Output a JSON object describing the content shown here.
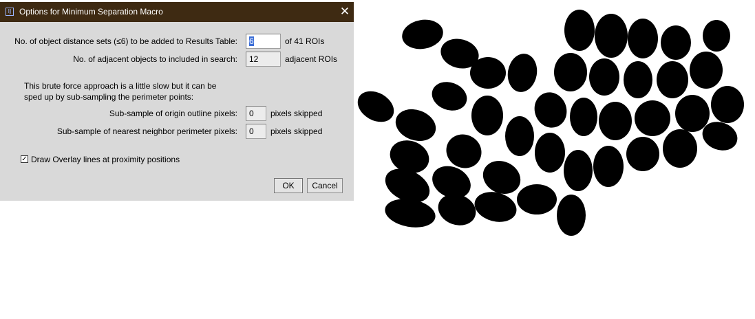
{
  "dialog": {
    "title": "Options for Minimum Separation Macro",
    "title_icon": "imagej-icon",
    "close_icon": "close-icon",
    "row1": {
      "label": "No. of object distance sets (≤6) to be added to Results Table:",
      "value": "6",
      "suffix": "of 41 ROIs"
    },
    "row2": {
      "label": "No. of adjacent objects to included in search:",
      "value": "12",
      "suffix": "adjacent ROIs"
    },
    "info_line1": "This brute force approach is a little slow but it can be",
    "info_line2": "sped up by sub-sampling the perimeter points:",
    "row3": {
      "label": "Sub-sample of origin outline pixels:",
      "value": "0",
      "suffix": "pixels skipped"
    },
    "row4": {
      "label": "Sub-sample of nearest neighbor perimeter pixels:",
      "value": "0",
      "suffix": "pixels skipped"
    },
    "overlay_checkbox": {
      "label": "Draw Overlay lines at proximity positions",
      "checked": true
    },
    "ok_label": "OK",
    "cancel_label": "Cancel"
  },
  "image": {
    "description": "binary mask of dark particles",
    "object_color": "#000000",
    "background_color": "#ffffff"
  }
}
